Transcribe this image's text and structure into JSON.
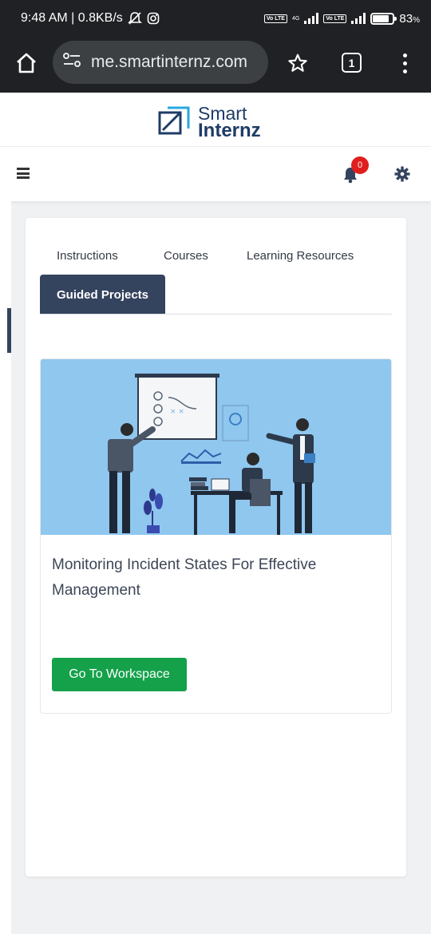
{
  "status_bar": {
    "time_speed": "9:48 AM | 0.8KB/s",
    "network": "4G",
    "lte1": "Vo LTE",
    "lte2": "Vo LTE",
    "battery": "83",
    "battery_unit": "%",
    "battery_level": 0.83
  },
  "browser": {
    "url": "me.smartinternz.com",
    "tab_count": "1"
  },
  "site": {
    "logo_line1": "Smart",
    "logo_line2": "Internz",
    "notification_count": "0",
    "brand_color": "#1f3c66"
  },
  "tabs": {
    "instructions": "Instructions",
    "courses": "Courses",
    "resources": "Learning Resources",
    "guided": "Guided Projects"
  },
  "project": {
    "title": "Monitoring Incident States For Effective Management",
    "button": "Go To Workspace",
    "button_color": "#14a14a"
  },
  "icons": [
    "home-icon",
    "site-settings-icon",
    "star-icon",
    "tabs-icon",
    "more-icon",
    "menu-icon",
    "bell-icon",
    "gear-icon"
  ]
}
